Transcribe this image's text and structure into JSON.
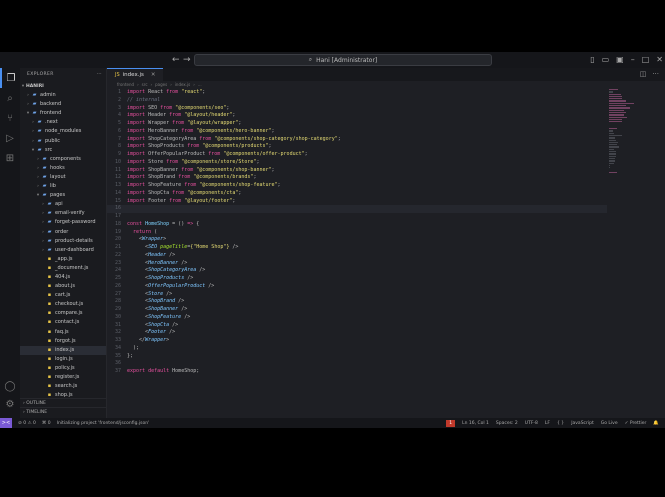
{
  "titlebar": {
    "back": "←",
    "forward": "→",
    "search_text": "Hani [Administrator]"
  },
  "explorer": {
    "title": "EXPLORER",
    "root": "HANIRI",
    "items": [
      {
        "label": "admin",
        "depth": 1,
        "kind": "folder",
        "open": false
      },
      {
        "label": "backend",
        "depth": 1,
        "kind": "folder",
        "open": false
      },
      {
        "label": "frontend",
        "depth": 1,
        "kind": "folder",
        "open": true
      },
      {
        "label": ".next",
        "depth": 2,
        "kind": "folder",
        "open": false
      },
      {
        "label": "node_modules",
        "depth": 2,
        "kind": "folder",
        "open": false
      },
      {
        "label": "public",
        "depth": 2,
        "kind": "folder",
        "open": false
      },
      {
        "label": "src",
        "depth": 2,
        "kind": "folder",
        "open": true
      },
      {
        "label": "components",
        "depth": 3,
        "kind": "folder",
        "open": false
      },
      {
        "label": "hooks",
        "depth": 3,
        "kind": "folder",
        "open": false
      },
      {
        "label": "layout",
        "depth": 3,
        "kind": "folder",
        "open": false
      },
      {
        "label": "lib",
        "depth": 3,
        "kind": "folder",
        "open": false
      },
      {
        "label": "pages",
        "depth": 3,
        "kind": "folder",
        "open": true
      },
      {
        "label": "api",
        "depth": 4,
        "kind": "folder",
        "open": false
      },
      {
        "label": "email-verify",
        "depth": 4,
        "kind": "folder",
        "open": false
      },
      {
        "label": "forget-password",
        "depth": 4,
        "kind": "folder",
        "open": false
      },
      {
        "label": "order",
        "depth": 4,
        "kind": "folder",
        "open": false
      },
      {
        "label": "product-details",
        "depth": 4,
        "kind": "folder",
        "open": false
      },
      {
        "label": "user-dashboard",
        "depth": 4,
        "kind": "folder",
        "open": false
      },
      {
        "label": "_app.js",
        "depth": 4,
        "kind": "file"
      },
      {
        "label": "_document.js",
        "depth": 4,
        "kind": "file"
      },
      {
        "label": "404.js",
        "depth": 4,
        "kind": "file"
      },
      {
        "label": "about.js",
        "depth": 4,
        "kind": "file"
      },
      {
        "label": "cart.js",
        "depth": 4,
        "kind": "file"
      },
      {
        "label": "checkout.js",
        "depth": 4,
        "kind": "file"
      },
      {
        "label": "compare.js",
        "depth": 4,
        "kind": "file"
      },
      {
        "label": "contact.js",
        "depth": 4,
        "kind": "file"
      },
      {
        "label": "faq.js",
        "depth": 4,
        "kind": "file"
      },
      {
        "label": "forgot.js",
        "depth": 4,
        "kind": "file"
      },
      {
        "label": "index.js",
        "depth": 4,
        "kind": "file",
        "selected": true
      },
      {
        "label": "login.js",
        "depth": 4,
        "kind": "file"
      },
      {
        "label": "policy.js",
        "depth": 4,
        "kind": "file"
      },
      {
        "label": "register.js",
        "depth": 4,
        "kind": "file"
      },
      {
        "label": "search.js",
        "depth": 4,
        "kind": "file"
      },
      {
        "label": "shop.js",
        "depth": 4,
        "kind": "file"
      }
    ],
    "outline": "OUTLINE",
    "timeline": "TIMELINE"
  },
  "editor": {
    "tab_label": "index.js",
    "breadcrumb": [
      "frontend",
      "src",
      "pages",
      "index.js",
      "..."
    ],
    "current_line": 16,
    "lines": [
      [
        [
          "k",
          "import"
        ],
        [
          "p",
          " React "
        ],
        [
          "k",
          "from"
        ],
        [
          "s",
          " \"react\""
        ],
        [
          "p",
          ";"
        ]
      ],
      [
        [
          "c",
          "// internal"
        ]
      ],
      [
        [
          "k",
          "import"
        ],
        [
          "p",
          " SEO "
        ],
        [
          "k",
          "from"
        ],
        [
          "s",
          " \"@components/seo\""
        ],
        [
          "p",
          ";"
        ]
      ],
      [
        [
          "k",
          "import"
        ],
        [
          "p",
          " Header "
        ],
        [
          "k",
          "from"
        ],
        [
          "s",
          " \"@layout/header\""
        ],
        [
          "p",
          ";"
        ]
      ],
      [
        [
          "k",
          "import"
        ],
        [
          "p",
          " Wrapper "
        ],
        [
          "k",
          "from"
        ],
        [
          "s",
          " \"@layout/wrapper\""
        ],
        [
          "p",
          ";"
        ]
      ],
      [
        [
          "k",
          "import"
        ],
        [
          "p",
          " HeroBanner "
        ],
        [
          "k",
          "from"
        ],
        [
          "s",
          " \"@components/hero-banner\""
        ],
        [
          "p",
          ";"
        ]
      ],
      [
        [
          "k",
          "import"
        ],
        [
          "p",
          " ShopCategoryArea "
        ],
        [
          "k",
          "from"
        ],
        [
          "s",
          " \"@components/shop-category/shop-category\""
        ],
        [
          "p",
          ";"
        ]
      ],
      [
        [
          "k",
          "import"
        ],
        [
          "p",
          " ShopProducts "
        ],
        [
          "k",
          "from"
        ],
        [
          "s",
          " \"@components/products\""
        ],
        [
          "p",
          ";"
        ]
      ],
      [
        [
          "k",
          "import"
        ],
        [
          "p",
          " OfferPopularProduct "
        ],
        [
          "k",
          "from"
        ],
        [
          "s",
          " \"@components/offer-product\""
        ],
        [
          "p",
          ";"
        ]
      ],
      [
        [
          "k",
          "import"
        ],
        [
          "p",
          " Store "
        ],
        [
          "k",
          "from"
        ],
        [
          "s",
          " \"@components/store/Store\""
        ],
        [
          "p",
          ";"
        ]
      ],
      [
        [
          "k",
          "import"
        ],
        [
          "p",
          " ShopBanner "
        ],
        [
          "k",
          "from"
        ],
        [
          "s",
          " \"@components/shop-banner\""
        ],
        [
          "p",
          ";"
        ]
      ],
      [
        [
          "k",
          "import"
        ],
        [
          "p",
          " ShopBrand "
        ],
        [
          "k",
          "from"
        ],
        [
          "s",
          " \"@components/brands\""
        ],
        [
          "p",
          ";"
        ]
      ],
      [
        [
          "k",
          "import"
        ],
        [
          "p",
          " ShopFeature "
        ],
        [
          "k",
          "from"
        ],
        [
          "s",
          " \"@components/shop-feature\""
        ],
        [
          "p",
          ";"
        ]
      ],
      [
        [
          "k",
          "import"
        ],
        [
          "p",
          " ShopCta "
        ],
        [
          "k",
          "from"
        ],
        [
          "s",
          " \"@components/cta\""
        ],
        [
          "p",
          ";"
        ]
      ],
      [
        [
          "k",
          "import"
        ],
        [
          "p",
          " Footer "
        ],
        [
          "k",
          "from"
        ],
        [
          "s",
          " \"@layout/footer\""
        ],
        [
          "p",
          ";"
        ]
      ],
      [
        [
          "p",
          ""
        ]
      ],
      [
        [
          "p",
          ""
        ]
      ],
      [
        [
          "k",
          "const"
        ],
        [
          "f",
          " HomeShop"
        ],
        [
          "p",
          " = () "
        ],
        [
          "k",
          "=>"
        ],
        [
          "p",
          " {"
        ]
      ],
      [
        [
          "p",
          "  "
        ],
        [
          "k",
          "return"
        ],
        [
          "p",
          " ("
        ]
      ],
      [
        [
          "p",
          "    <"
        ],
        [
          "t",
          "Wrapper"
        ],
        [
          "p",
          ">"
        ]
      ],
      [
        [
          "p",
          "      <"
        ],
        [
          "t",
          "SEO"
        ],
        [
          "a",
          " pageTitle"
        ],
        [
          "p",
          "="
        ],
        [
          "s",
          "{\"Home Shop\"}"
        ],
        [
          "p",
          " />"
        ]
      ],
      [
        [
          "p",
          "      <"
        ],
        [
          "t",
          "Header"
        ],
        [
          "p",
          " />"
        ]
      ],
      [
        [
          "p",
          "      <"
        ],
        [
          "t",
          "HeroBanner"
        ],
        [
          "p",
          " />"
        ]
      ],
      [
        [
          "p",
          "      <"
        ],
        [
          "t",
          "ShopCategoryArea"
        ],
        [
          "p",
          " />"
        ]
      ],
      [
        [
          "p",
          "      <"
        ],
        [
          "t",
          "ShopProducts"
        ],
        [
          "p",
          " />"
        ]
      ],
      [
        [
          "p",
          "      <"
        ],
        [
          "t",
          "OfferPopularProduct"
        ],
        [
          "p",
          " />"
        ]
      ],
      [
        [
          "p",
          "      <"
        ],
        [
          "t",
          "Store"
        ],
        [
          "p",
          " />"
        ]
      ],
      [
        [
          "p",
          "      <"
        ],
        [
          "t",
          "ShopBrand"
        ],
        [
          "p",
          " />"
        ]
      ],
      [
        [
          "p",
          "      <"
        ],
        [
          "t",
          "ShopBanner"
        ],
        [
          "p",
          " />"
        ]
      ],
      [
        [
          "p",
          "      <"
        ],
        [
          "t",
          "ShopFeature"
        ],
        [
          "p",
          " />"
        ]
      ],
      [
        [
          "p",
          "      <"
        ],
        [
          "t",
          "ShopCta"
        ],
        [
          "p",
          " />"
        ]
      ],
      [
        [
          "p",
          "      <"
        ],
        [
          "t",
          "Footer"
        ],
        [
          "p",
          " />"
        ]
      ],
      [
        [
          "p",
          "    </"
        ],
        [
          "t",
          "Wrapper"
        ],
        [
          "p",
          ">"
        ]
      ],
      [
        [
          "p",
          "  );"
        ]
      ],
      [
        [
          "p",
          "};"
        ]
      ],
      [
        [
          "p",
          ""
        ]
      ],
      [
        [
          "k",
          "export"
        ],
        [
          "k",
          " default"
        ],
        [
          "p",
          " HomeShop;"
        ]
      ]
    ]
  },
  "statusbar": {
    "remote": "><",
    "errors": "⊘ 0 ⚠ 0",
    "ports": "⌘ 0",
    "message": "Initializing project 'frontend/jsconfig.json'",
    "badge": "1",
    "position": "Ln 16, Col 1",
    "spaces": "Spaces: 2",
    "encoding": "UTF-8",
    "eol": "LF",
    "braces": "{ }",
    "language": "JavaScript",
    "golive": "Go Live",
    "prettier": "✓ Prettier",
    "bell": "🔔"
  },
  "colors": {
    "accent": "#4a8ff0",
    "folder": "#6fa3e8",
    "js_file": "#e7c547",
    "remote": "#7a5ad6"
  }
}
